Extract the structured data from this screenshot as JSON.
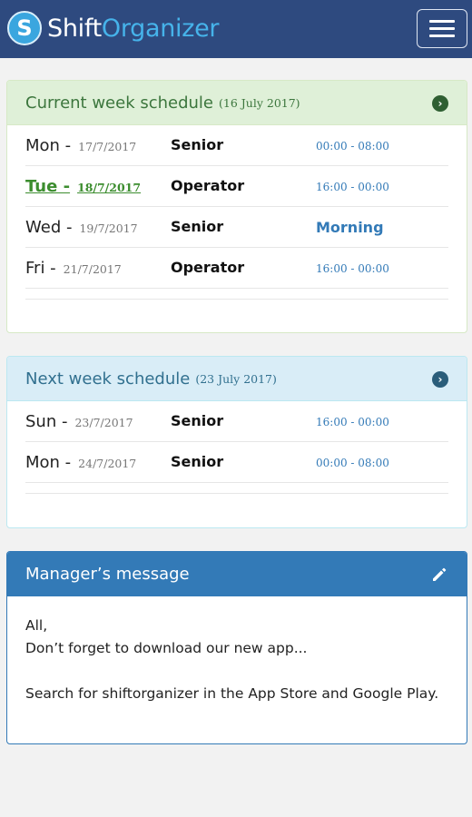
{
  "app": {
    "brand_primary": "Shift",
    "brand_secondary": "Organizer",
    "logo_letter": "S",
    "menu_icon": "hamburger-menu-icon"
  },
  "current_week": {
    "title": "Current week schedule",
    "date": "(16 July 2017)",
    "action_icon": "chevron-right-circle-icon",
    "shifts": [
      {
        "day": "Mon -",
        "date": "17/7/2017",
        "role": "Senior",
        "time": "00:00 - 08:00"
      },
      {
        "day": "Tue -",
        "date": "18/7/2017",
        "role": "Operator",
        "time": "16:00 - 00:00"
      },
      {
        "day": "Wed -",
        "date": "19/7/2017",
        "role": "Senior",
        "time": "Morning"
      },
      {
        "day": "Fri -",
        "date": "21/7/2017",
        "role": "Operator",
        "time": "16:00 - 00:00"
      }
    ]
  },
  "next_week": {
    "title": "Next week schedule",
    "date": "(23 July 2017)",
    "action_icon": "chevron-right-circle-icon",
    "shifts": [
      {
        "day": "Sun -",
        "date": "23/7/2017",
        "role": "Senior",
        "time": "16:00 - 00:00"
      },
      {
        "day": "Mon -",
        "date": "24/7/2017",
        "role": "Senior",
        "time": "00:00 - 08:00"
      }
    ]
  },
  "manager_message": {
    "title": "Manager’s message",
    "edit_icon": "pencil-icon",
    "lines": [
      "All,",
      "Don’t forget to download our new app...",
      "Search for shiftorganizer in the App Store and Google Play."
    ]
  },
  "colors": {
    "navbar": "#2e4a7f",
    "success_bg": "#dff0d8",
    "info_bg": "#d9edf7",
    "primary": "#337ab7",
    "today": "#3c8d2f"
  }
}
